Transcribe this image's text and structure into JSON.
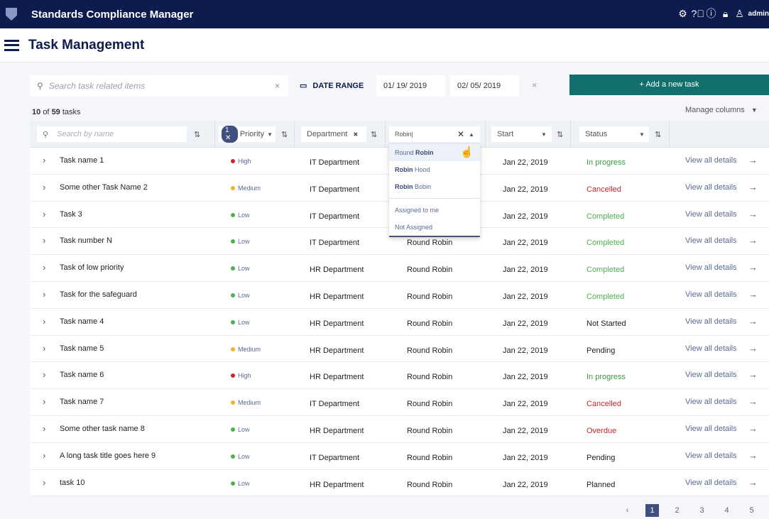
{
  "app": {
    "title": "Standards Compliance Manager",
    "user": "admin",
    "icons": [
      "gear-icon",
      "help-icon",
      "info-icon",
      "lock-icon",
      "user-icon"
    ]
  },
  "page": {
    "title": "Task Management"
  },
  "toolbar": {
    "search_placeholder": "Search task related items",
    "date_range_label": "DATE RANGE",
    "date_from": "01/ 19/ 2019",
    "date_to": "02/ 05/ 2019",
    "add_label": "+ Add a new task"
  },
  "summary": {
    "shown": "10",
    "of": "of",
    "total": "59",
    "unit": "tasks",
    "manage_columns": "Manage columns"
  },
  "columns": {
    "name_placeholder": "Search by name",
    "priority_badge": "1",
    "priority": "Priority",
    "department": "Department",
    "assignee_value": "Robin|",
    "start": "Start",
    "status": "Status"
  },
  "dropdown": {
    "items": [
      {
        "pre": "Round ",
        "bold": "Robin",
        "post": ""
      },
      {
        "pre": "",
        "bold": "Robin",
        "post": " Hood"
      },
      {
        "pre": "",
        "bold": "Robin",
        "post": " Bobin"
      }
    ],
    "extra": [
      "Assigned to me",
      "Not Assigned"
    ]
  },
  "priority_colors": {
    "High": "#d0202a",
    "Medium": "#f0b429",
    "Low": "#4caf50"
  },
  "status_colors": {
    "In progress": "#3a9c3f",
    "Cancelled": "#c62828",
    "Completed": "#4caf50",
    "Overdue": "#c62828",
    "Not Started": "#222",
    "Pending": "#222",
    "Planned": "#222"
  },
  "rows": [
    {
      "name": "Task name 1",
      "priority": "High",
      "department": "IT Department",
      "assignee": "",
      "start": "Jan 22, 2019",
      "status": "In progress",
      "action": "View all details"
    },
    {
      "name": "Some other Task Name 2",
      "priority": "Medium",
      "department": "IT Department",
      "assignee": "",
      "start": "Jan 22, 2019",
      "status": "Cancelled",
      "action": "View all details"
    },
    {
      "name": "Task 3",
      "priority": "Low",
      "department": "IT Department",
      "assignee": "",
      "start": "Jan 22, 2019",
      "status": "Completed",
      "action": "View all details"
    },
    {
      "name": "Task number N",
      "priority": "Low",
      "department": "IT Department",
      "assignee": "Round Robin",
      "start": "Jan 22, 2019",
      "status": "Completed",
      "action": "View all details"
    },
    {
      "name": "Task of low priority",
      "priority": "Low",
      "department": "HR Department",
      "assignee": "Round Robin",
      "start": "Jan 22, 2019",
      "status": "Completed",
      "action": "View all details"
    },
    {
      "name": "Task for the safeguard",
      "priority": "Low",
      "department": "HR Department",
      "assignee": "Round Robin",
      "start": "Jan 22, 2019",
      "status": "Completed",
      "action": "View all details"
    },
    {
      "name": "Task name 4",
      "priority": "Low",
      "department": "HR Department",
      "assignee": "Round Robin",
      "start": "Jan 22, 2019",
      "status": "Not Started",
      "action": "View all details"
    },
    {
      "name": "Task name 5",
      "priority": "Medium",
      "department": "HR Department",
      "assignee": "Round Robin",
      "start": "Jan 22, 2019",
      "status": "Pending",
      "action": "View all details"
    },
    {
      "name": "Task name 6",
      "priority": "High",
      "department": "HR Department",
      "assignee": "Round Robin",
      "start": "Jan 22, 2019",
      "status": "In progress",
      "action": "View all details"
    },
    {
      "name": "Task name 7",
      "priority": "Medium",
      "department": "IT Department",
      "assignee": "Round Robin",
      "start": "Jan 22, 2019",
      "status": "Cancelled",
      "action": "View all details"
    },
    {
      "name": "Some other task name 8",
      "priority": "Low",
      "department": "HR Department",
      "assignee": "Round Robin",
      "start": "Jan 22, 2019",
      "status": "Overdue",
      "action": "View all details"
    },
    {
      "name": "A long task title goes here 9",
      "priority": "Low",
      "department": "IT Department",
      "assignee": "Round Robin",
      "start": "Jan 22, 2019",
      "status": "Pending",
      "action": "View all details"
    },
    {
      "name": "task 10",
      "priority": "Low",
      "department": "HR Department",
      "assignee": "Round Robin",
      "start": "Jan 22, 2019",
      "status": "Planned",
      "action": "View all details"
    }
  ],
  "pagination": {
    "current": "1",
    "pages": [
      "2",
      "3",
      "4",
      "5"
    ]
  }
}
